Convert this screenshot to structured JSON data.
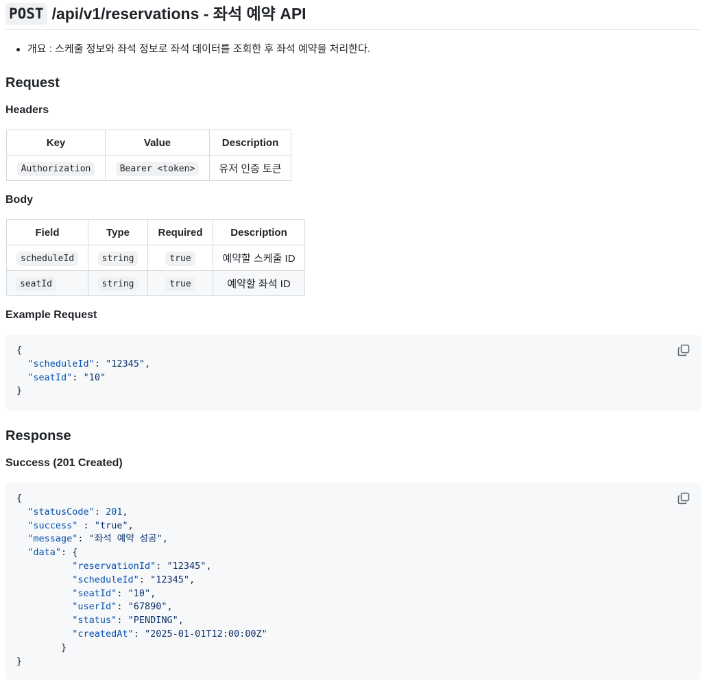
{
  "title": {
    "method": "POST",
    "rest": "/api/v1/reservations - 좌석 예약 API"
  },
  "overview": "개요 : 스케줄 정보와 좌석 정보로 좌석 데이터를 조회한 후 좌석 예약을 처리한다.",
  "request": {
    "heading": "Request",
    "headers_heading": "Headers",
    "headers_table": {
      "columns": [
        "Key",
        "Value",
        "Description"
      ],
      "rows": [
        [
          "Authorization",
          "Bearer <token>",
          "유저 인증 토큰"
        ]
      ]
    },
    "body_heading": "Body",
    "body_table": {
      "columns": [
        "Field",
        "Type",
        "Required",
        "Description"
      ],
      "rows": [
        [
          "scheduleId",
          "string",
          "true",
          "예약할 스케줄 ID"
        ],
        [
          "seatId",
          "string",
          "true",
          "예약할 좌석 ID"
        ]
      ]
    },
    "example_heading": "Example Request",
    "example_lines": [
      [
        {
          "t": "p",
          "v": "{"
        }
      ],
      [
        {
          "t": "p",
          "v": "  "
        },
        {
          "t": "k",
          "v": "\"scheduleId\""
        },
        {
          "t": "p",
          "v": ": "
        },
        {
          "t": "s",
          "v": "\"12345\""
        },
        {
          "t": "p",
          "v": ","
        }
      ],
      [
        {
          "t": "p",
          "v": "  "
        },
        {
          "t": "k",
          "v": "\"seatId\""
        },
        {
          "t": "p",
          "v": ": "
        },
        {
          "t": "s",
          "v": "\"10\""
        }
      ],
      [
        {
          "t": "p",
          "v": "}"
        }
      ]
    ]
  },
  "response": {
    "heading": "Response",
    "success_heading": "Success (201 Created)",
    "example_lines": [
      [
        {
          "t": "p",
          "v": "{"
        }
      ],
      [
        {
          "t": "p",
          "v": "  "
        },
        {
          "t": "k",
          "v": "\"statusCode\""
        },
        {
          "t": "p",
          "v": ": "
        },
        {
          "t": "n",
          "v": "201"
        },
        {
          "t": "p",
          "v": ","
        }
      ],
      [
        {
          "t": "p",
          "v": "  "
        },
        {
          "t": "k",
          "v": "\"success\""
        },
        {
          "t": "p",
          "v": " : "
        },
        {
          "t": "s",
          "v": "\"true\""
        },
        {
          "t": "p",
          "v": ","
        }
      ],
      [
        {
          "t": "p",
          "v": "  "
        },
        {
          "t": "k",
          "v": "\"message\""
        },
        {
          "t": "p",
          "v": ": "
        },
        {
          "t": "s",
          "v": "\"좌석 예약 성공\""
        },
        {
          "t": "p",
          "v": ","
        }
      ],
      [
        {
          "t": "p",
          "v": "  "
        },
        {
          "t": "k",
          "v": "\"data\""
        },
        {
          "t": "p",
          "v": ": {"
        }
      ],
      [
        {
          "t": "p",
          "v": "          "
        },
        {
          "t": "k",
          "v": "\"reservationId\""
        },
        {
          "t": "p",
          "v": ": "
        },
        {
          "t": "s",
          "v": "\"12345\""
        },
        {
          "t": "p",
          "v": ","
        }
      ],
      [
        {
          "t": "p",
          "v": "          "
        },
        {
          "t": "k",
          "v": "\"scheduleId\""
        },
        {
          "t": "p",
          "v": ": "
        },
        {
          "t": "s",
          "v": "\"12345\""
        },
        {
          "t": "p",
          "v": ","
        }
      ],
      [
        {
          "t": "p",
          "v": "          "
        },
        {
          "t": "k",
          "v": "\"seatId\""
        },
        {
          "t": "p",
          "v": ": "
        },
        {
          "t": "s",
          "v": "\"10\""
        },
        {
          "t": "p",
          "v": ","
        }
      ],
      [
        {
          "t": "p",
          "v": "          "
        },
        {
          "t": "k",
          "v": "\"userId\""
        },
        {
          "t": "p",
          "v": ": "
        },
        {
          "t": "s",
          "v": "\"67890\""
        },
        {
          "t": "p",
          "v": ","
        }
      ],
      [
        {
          "t": "p",
          "v": "          "
        },
        {
          "t": "k",
          "v": "\"status\""
        },
        {
          "t": "p",
          "v": ": "
        },
        {
          "t": "s",
          "v": "\"PENDING\""
        },
        {
          "t": "p",
          "v": ","
        }
      ],
      [
        {
          "t": "p",
          "v": "          "
        },
        {
          "t": "k",
          "v": "\"createdAt\""
        },
        {
          "t": "p",
          "v": ": "
        },
        {
          "t": "s",
          "v": "\"2025-01-01T12:00:00Z\""
        }
      ],
      [
        {
          "t": "p",
          "v": "        }"
        }
      ],
      [
        {
          "t": "p",
          "v": "}"
        }
      ]
    ]
  },
  "icons": {
    "copy": "copy-icon"
  },
  "colors": {
    "key": "#0550ae",
    "string": "#0a3069",
    "code_bg": "#f6f8fa",
    "border": "#d1d9e0"
  }
}
